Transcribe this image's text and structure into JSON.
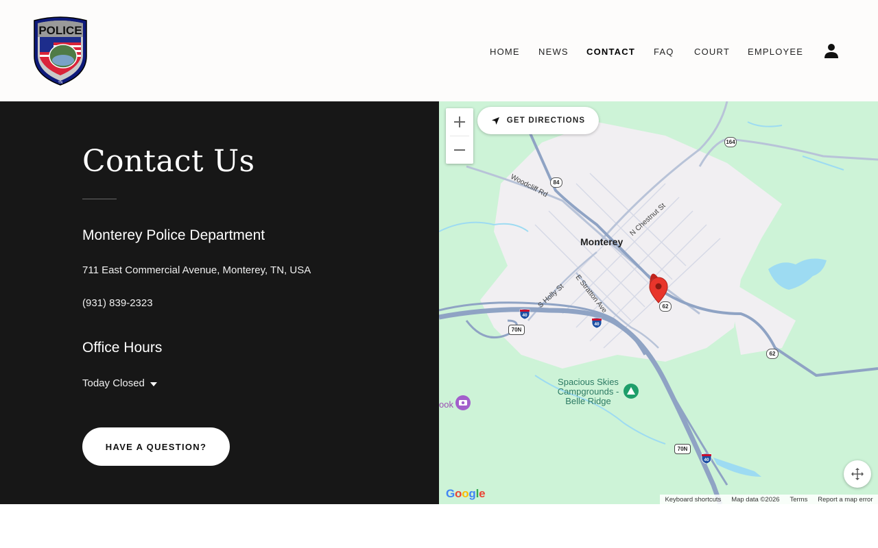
{
  "header": {
    "logo_alt": "Police badge logo",
    "nav": [
      {
        "label": "HOME"
      },
      {
        "label": "NEWS"
      },
      {
        "label": "CONTACT"
      },
      {
        "label": "FAQ"
      },
      {
        "label": "COURT"
      },
      {
        "label": "EMPLOYEE"
      }
    ],
    "active_nav": "CONTACT",
    "account_icon": "user-icon"
  },
  "contact": {
    "title": "Contact Us",
    "department": "Monterey Police Department",
    "address": "711 East Commercial Avenue, Monterey, TN, USA",
    "phone": "(931) 839-2323",
    "hours_title": "Office Hours",
    "hours_status": "Today Closed",
    "question_button": "HAVE A QUESTION?"
  },
  "map": {
    "directions_label": "GET DIRECTIONS",
    "city_label": "Monterey",
    "streets": [
      "Woodcliff Rd",
      "N Chestnut St",
      "S Holly St",
      "E Stratton Ave"
    ],
    "route_shields": [
      "164",
      "84",
      "62",
      "62",
      "70N",
      "70N"
    ],
    "interstate_shields": [
      "40",
      "40",
      "40"
    ],
    "poi": "Spacious Skies Campgrounds - Belle Ridge",
    "edge_poi": "ook",
    "attribution": {
      "keyboard": "Keyboard shortcuts",
      "map_data": "Map data ©2026",
      "terms": "Terms",
      "report": "Report a map error"
    },
    "google": "Google",
    "colors": {
      "land": "#cdf3d7",
      "urban": "#f1eff2",
      "highway": "#8fa3c4",
      "water": "#9ddbf2",
      "marker": "#e8352b"
    }
  },
  "colors": {
    "header_bg": "#fdfcfb",
    "panel_bg": "#171717",
    "button_bg": "#ffffff"
  }
}
